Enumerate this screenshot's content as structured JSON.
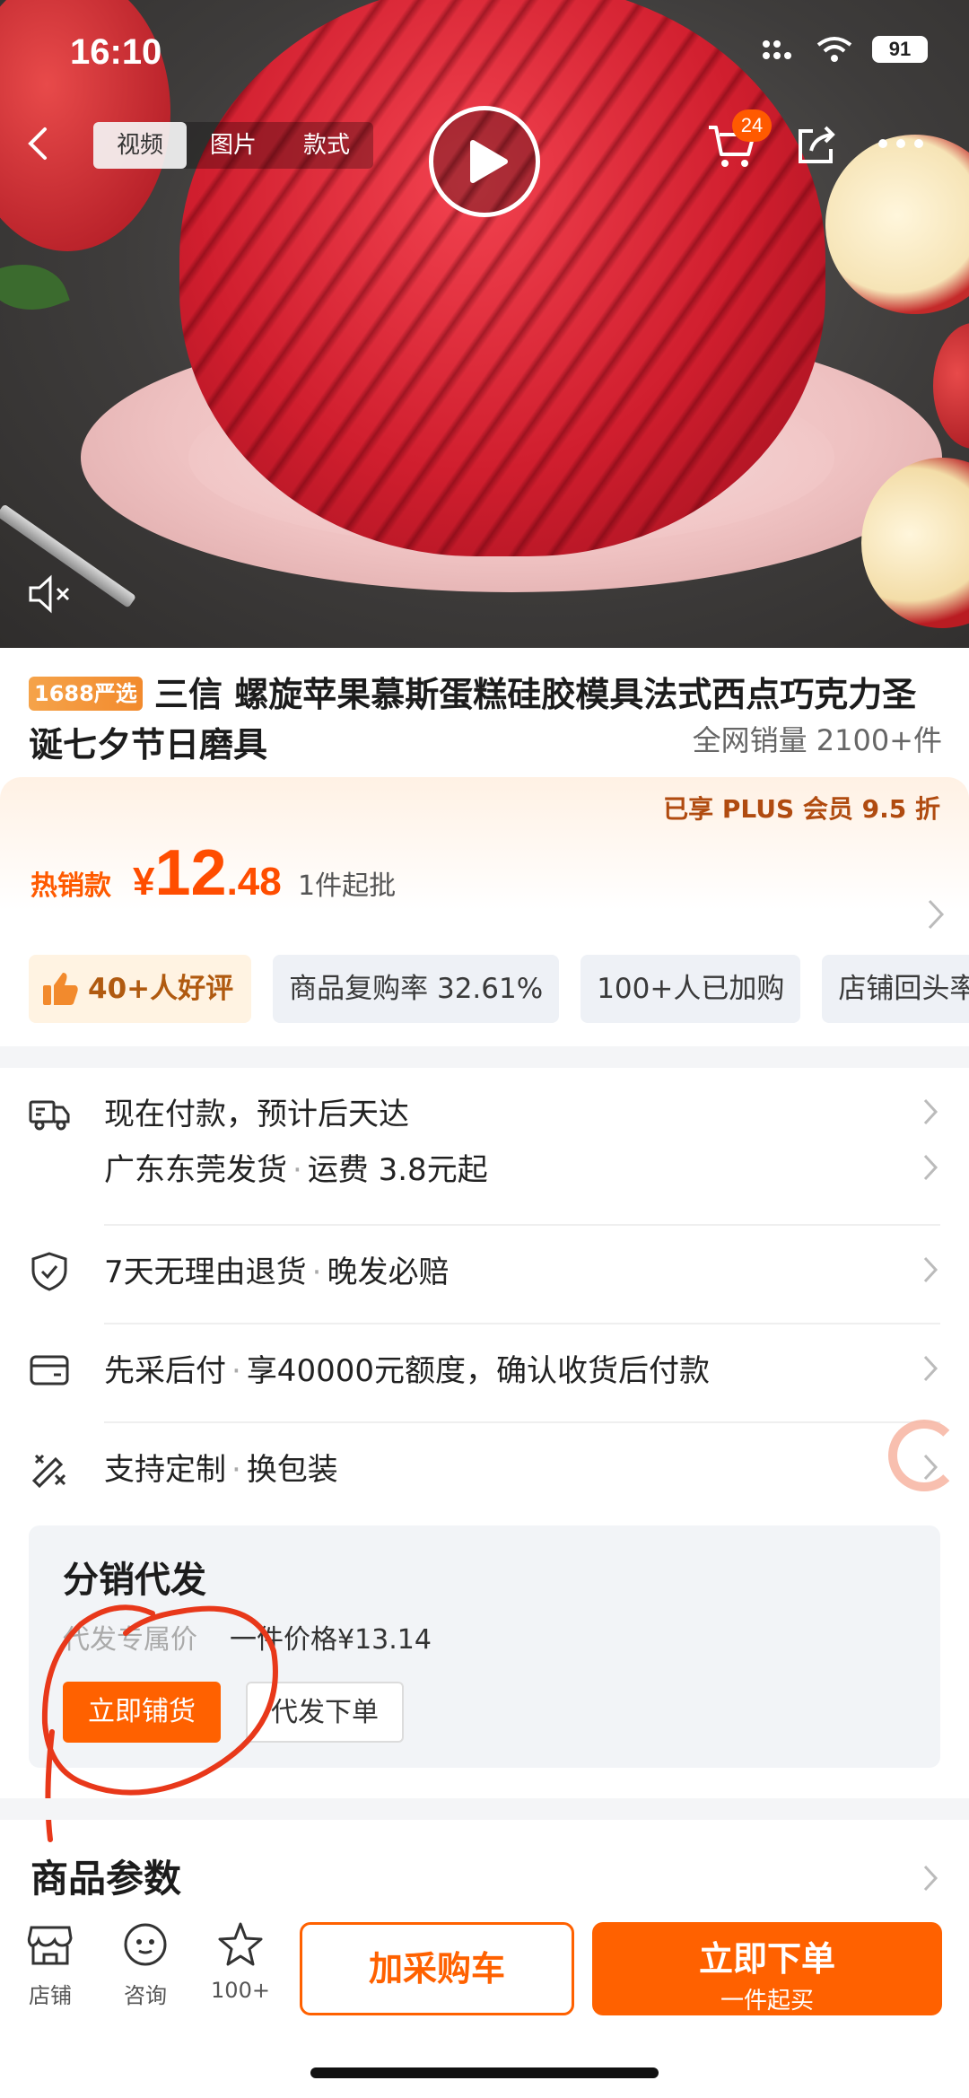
{
  "status_bar": {
    "time": "16:10",
    "battery": "91"
  },
  "header": {
    "media_tabs": [
      {
        "label": "视频",
        "active": true
      },
      {
        "label": "图片",
        "active": false
      },
      {
        "label": "款式",
        "active": false
      }
    ],
    "cart_badge": "24",
    "icons": [
      "back-icon",
      "play-icon",
      "cart-icon",
      "share-icon",
      "more-icon",
      "mute-icon"
    ]
  },
  "product": {
    "badge": "1688严选",
    "title": "三信 螺旋苹果慕斯蛋糕硅胶模具法式西点巧克力圣诞七夕节日磨具",
    "sales": "全网销量 2100+件",
    "plus_discount": "已享 PLUS 会员 9.5 折",
    "hot_label": "热销款",
    "price": {
      "currency": "¥",
      "integer": "12",
      "decimal": ".48"
    },
    "moq": "1件起批"
  },
  "tags": [
    {
      "label": "40+人好评"
    },
    {
      "label": "商品复购率 32.61%"
    },
    {
      "label": "100+人已加购"
    },
    {
      "label": "店铺回头率"
    }
  ],
  "services": {
    "shipping": {
      "line1": "现在付款，预计后天达",
      "line2_origin": "广东东莞发货",
      "line2_fee": "运费 3.8元起"
    },
    "returns": {
      "a": "7天无理由退货",
      "b": "晚发必赔"
    },
    "credit": {
      "a": "先采后付",
      "b": "享40000元额度，确认收货后付款"
    },
    "custom": {
      "a": "支持定制",
      "b": "换包装"
    }
  },
  "distribution": {
    "title": "分销代发",
    "sub_label": "代发专属价",
    "single_price": "一件价格¥13.14",
    "btn_stock": "立即铺货",
    "btn_dropship": "代发下单"
  },
  "params_title": "商品参数",
  "bottom_bar": {
    "shop": "店铺",
    "consult": "咨询",
    "fav": "100+",
    "add_cart": "加采购车",
    "buy_now": "立即下单",
    "buy_sub": "一件起买"
  },
  "colors": {
    "accent": "#ff6100",
    "price": "#ff4d00",
    "annotation": "#e8381a"
  }
}
